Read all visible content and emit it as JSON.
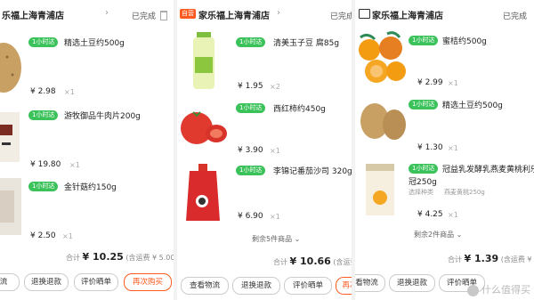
{
  "colors": {
    "accent": "#ff5a1f",
    "fast_badge": "#3bc25a"
  },
  "panel1": {
    "shop": "乐福上海青浦店",
    "status": "已完成",
    "items": [
      {
        "badge": "1小时达",
        "name": "精选土豆约500g",
        "price": "¥ 2.98",
        "qty": "×1"
      },
      {
        "badge": "1小时达",
        "name": "游牧御品牛肉片200g",
        "price": "¥ 19.80",
        "qty": "×1"
      },
      {
        "badge": "1小时达",
        "name": "金针菇约150g",
        "price": "¥ 2.50",
        "qty": "×1"
      }
    ],
    "total": {
      "label": "合计",
      "amount": "¥ 10.25",
      "freight": "(含运费 ¥ 5.00)"
    },
    "buttons": {
      "logistics": "流",
      "refund": "退换退款",
      "review": "评价晒单",
      "rebuy": "再次购买"
    }
  },
  "panel2": {
    "self_badge": "自营",
    "shop": "家乐福上海青浦店",
    "status": "已完成",
    "items": [
      {
        "badge": "1小时达",
        "name": "清美玉子豆 腐85g",
        "price": "¥ 1.95",
        "qty": "×2"
      },
      {
        "badge": "1小时达",
        "name": "西红柿约450g",
        "price": "¥ 3.90",
        "qty": "×1"
      },
      {
        "badge": "1小时达",
        "name": "李锦记番茄沙司 320g",
        "price": "¥ 6.90",
        "qty": "×1"
      }
    ],
    "remaining": "剩余5件商品",
    "total": {
      "label": "合计",
      "amount": "¥ 10.66",
      "freight": "(含运费 ¥ 5"
    },
    "buttons": {
      "logistics": "查看物流",
      "refund": "退换退款",
      "review": "评价晒单",
      "rebuy": "再次"
    }
  },
  "panel3": {
    "shop": "家乐福上海青浦店",
    "status": "已完成",
    "items": [
      {
        "badge": "1小时达",
        "name": "蜜桔约500g",
        "price": "¥ 2.99",
        "qty": "×1"
      },
      {
        "badge": "1小时达",
        "name": "精选土豆约500g",
        "price": "¥ 1.30",
        "qty": "×1"
      },
      {
        "badge": "1小时达",
        "name": "冠益乳发酵乳燕麦黄桃利乐",
        "name2": "冠250g",
        "spec_label": "选择种类",
        "spec_value": "燕麦黄桃250g",
        "price": "¥ 4.25",
        "qty": "×1"
      }
    ],
    "remaining": "剩余2件商品",
    "total": {
      "label": "合计",
      "amount": "¥ 1.39",
      "freight": "(含运费 ¥ 0.0"
    },
    "buttons": {
      "logistics": "看物流",
      "refund": "退换退款",
      "review": "评价晒单"
    },
    "watermark": "什么值得买"
  }
}
